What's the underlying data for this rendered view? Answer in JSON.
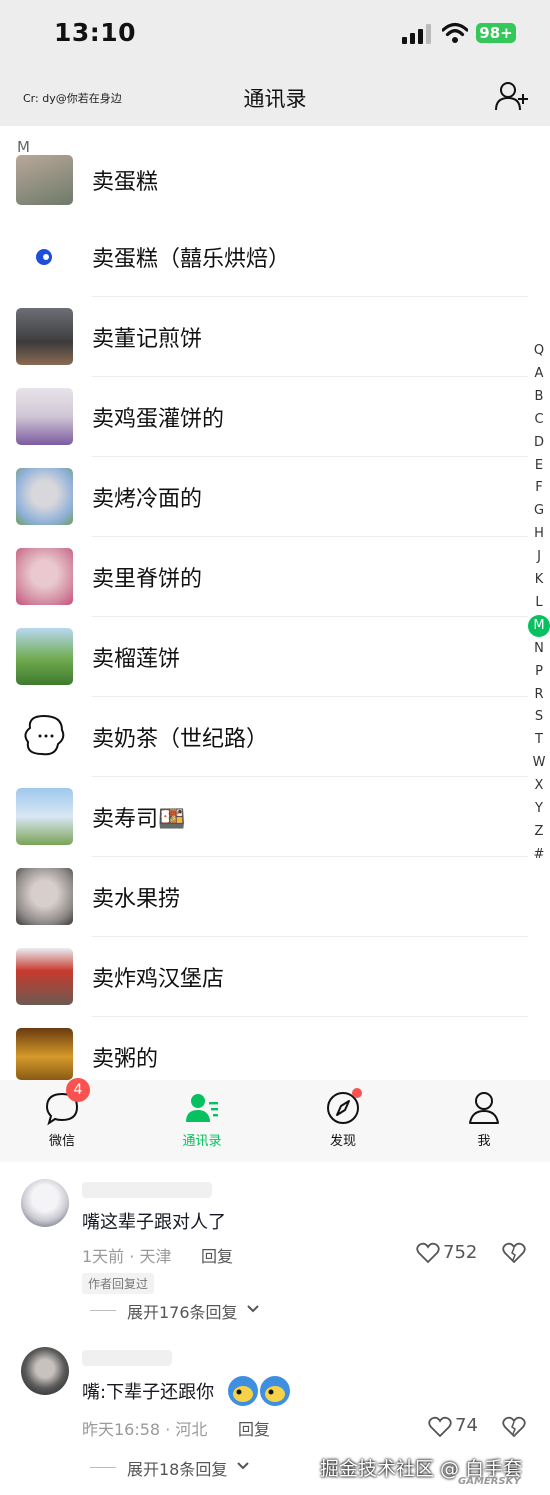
{
  "status_bar": {
    "time": "13:10",
    "battery": "98+"
  },
  "nav": {
    "credit": "Cr: dy@你若在身边",
    "title": "通讯录"
  },
  "list": {
    "section_letter": "M",
    "contacts": [
      {
        "name": "卖蛋糕"
      },
      {
        "name": "卖蛋糕（囍乐烘焙）"
      },
      {
        "name": "卖董记煎饼"
      },
      {
        "name": "卖鸡蛋灌饼的"
      },
      {
        "name": "卖烤冷面的"
      },
      {
        "name": "卖里脊饼的"
      },
      {
        "name": "卖榴莲饼"
      },
      {
        "name": "卖奶茶（世纪路）"
      },
      {
        "name": "卖寿司🍱"
      },
      {
        "name": "卖水果捞"
      },
      {
        "name": "卖炸鸡汉堡店"
      },
      {
        "name": "卖粥的"
      }
    ]
  },
  "alphabet": [
    "Q",
    "A",
    "B",
    "C",
    "D",
    "E",
    "F",
    "G",
    "H",
    "J",
    "K",
    "L",
    "M",
    "N",
    "P",
    "R",
    "S",
    "T",
    "W",
    "X",
    "Y",
    "Z",
    "#"
  ],
  "alphabet_active": "M",
  "tabs": {
    "chats": "微信",
    "contacts": "通讯录",
    "discover": "发现",
    "me": "我",
    "chats_badge": "4"
  },
  "comments": [
    {
      "text": "嘴这辈子跟对人了",
      "meta": "1天前 · 天津",
      "reply": "回复",
      "likes": "752",
      "tag": "作者回复过",
      "expand": "展开176条回复"
    },
    {
      "text": "嘴:下辈子还跟你",
      "meta": "昨天16:58 · 河北",
      "reply": "回复",
      "likes": "74",
      "expand": "展开18条回复"
    }
  ],
  "watermark": "掘金技术社区 @ 白手套",
  "watermark_small": "GAMERSKY",
  "colors": {
    "accent": "#07c160",
    "badge": "#fa5151",
    "nav_bg": "#ededed"
  }
}
